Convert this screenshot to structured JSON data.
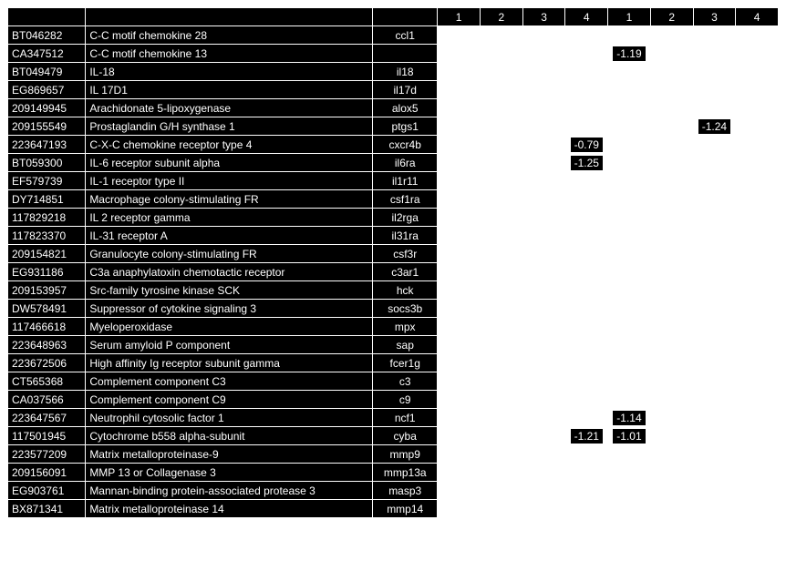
{
  "header": {
    "blank_cols": 3,
    "numbers": [
      "1",
      "2",
      "3",
      "4",
      "1",
      "2",
      "3",
      "4"
    ]
  },
  "rows": [
    {
      "id": "BT046282",
      "name": "C-C motif chemokine 28",
      "gene": "ccl1",
      "vals": [
        "",
        "",
        "",
        "",
        "",
        "",
        "",
        ""
      ]
    },
    {
      "id": "CA347512",
      "name": "C-C motif chemokine 13",
      "gene": "",
      "vals": [
        "",
        "",
        "",
        "",
        "-1.19",
        "",
        "",
        ""
      ]
    },
    {
      "id": "BT049479",
      "name": "IL-18",
      "gene": "il18",
      "vals": [
        "",
        "",
        "",
        "",
        "",
        "",
        "",
        ""
      ]
    },
    {
      "id": "EG869657",
      "name": "IL 17D1",
      "gene": "il17d",
      "vals": [
        "",
        "",
        "",
        "",
        "",
        "",
        "",
        ""
      ]
    },
    {
      "id": "209149945",
      "name": "Arachidonate 5-lipoxygenase",
      "gene": "alox5",
      "vals": [
        "",
        "",
        "",
        "",
        "",
        "",
        "",
        ""
      ]
    },
    {
      "id": "209155549",
      "name": "Prostaglandin G/H synthase 1",
      "gene": "ptgs1",
      "vals": [
        "",
        "",
        "",
        "",
        "",
        "",
        "-1.24",
        ""
      ]
    },
    {
      "id": "223647193",
      "name": "C-X-C chemokine receptor type 4",
      "gene": "cxcr4b",
      "vals": [
        "",
        "",
        "",
        "-0.79",
        "",
        "",
        "",
        ""
      ]
    },
    {
      "id": "BT059300",
      "name": "IL-6 receptor subunit alpha",
      "gene": "il6ra",
      "vals": [
        "",
        "",
        "",
        "-1.25",
        "",
        "",
        "",
        ""
      ]
    },
    {
      "id": "EF579739",
      "name": "IL-1 receptor type II",
      "gene": "il1r11",
      "vals": [
        "",
        "",
        "",
        "",
        "",
        "",
        "",
        ""
      ]
    },
    {
      "id": "DY714851",
      "name": "Macrophage colony-stimulating FR",
      "gene": "csf1ra",
      "vals": [
        "",
        "",
        "",
        "",
        "",
        "",
        "",
        ""
      ]
    },
    {
      "id": "117829218",
      "name": "IL 2 receptor gamma",
      "gene": "il2rga",
      "vals": [
        "",
        "",
        "",
        "",
        "",
        "",
        "",
        ""
      ]
    },
    {
      "id": "117823370",
      "name": "IL-31 receptor A",
      "gene": "il31ra",
      "vals": [
        "",
        "",
        "",
        "",
        "",
        "",
        "",
        ""
      ]
    },
    {
      "id": "209154821",
      "name": "Granulocyte colony-stimulating FR",
      "gene": "csf3r",
      "vals": [
        "",
        "",
        "",
        "",
        "",
        "",
        "",
        ""
      ]
    },
    {
      "id": "EG931186",
      "name": "C3a anaphylatoxin chemotactic receptor",
      "gene": "c3ar1",
      "vals": [
        "",
        "",
        "",
        "",
        "",
        "",
        "",
        ""
      ]
    },
    {
      "id": "209153957",
      "name": "Src-family tyrosine kinase SCK",
      "gene": "hck",
      "vals": [
        "",
        "",
        "",
        "",
        "",
        "",
        "",
        ""
      ]
    },
    {
      "id": "DW578491",
      "name": "Suppressor of cytokine signaling 3",
      "gene": "socs3b",
      "vals": [
        "",
        "",
        "",
        "",
        "",
        "",
        "",
        ""
      ]
    },
    {
      "id": "117466618",
      "name": "Myeloperoxidase",
      "gene": "mpx",
      "vals": [
        "",
        "",
        "",
        "",
        "",
        "",
        "",
        ""
      ]
    },
    {
      "id": "223648963",
      "name": "Serum amyloid P component",
      "gene": "sap",
      "vals": [
        "",
        "",
        "",
        "",
        "",
        "",
        "",
        ""
      ]
    },
    {
      "id": "223672506",
      "name": "High affinity Ig receptor subunit gamma",
      "gene": "fcer1g",
      "vals": [
        "",
        "",
        "",
        "",
        "",
        "",
        "",
        ""
      ]
    },
    {
      "id": "CT565368",
      "name": "Complement component C3",
      "gene": "c3",
      "vals": [
        "",
        "",
        "",
        "",
        "",
        "",
        "",
        ""
      ]
    },
    {
      "id": "CA037566",
      "name": "Complement component C9",
      "gene": "c9",
      "vals": [
        "",
        "",
        "",
        "",
        "",
        "",
        "",
        ""
      ]
    },
    {
      "id": "223647567",
      "name": "Neutrophil cytosolic factor 1",
      "gene": "ncf1",
      "vals": [
        "",
        "",
        "",
        "",
        "-1.14",
        "",
        "",
        ""
      ]
    },
    {
      "id": "117501945",
      "name": "Cytochrome b558 alpha-subunit",
      "gene": "cyba",
      "vals": [
        "",
        "",
        "",
        "-1.21",
        "-1.01",
        "",
        "",
        ""
      ]
    },
    {
      "id": "223577209",
      "name": "Matrix metalloproteinase-9",
      "gene": "mmp9",
      "vals": [
        "",
        "",
        "",
        "",
        "",
        "",
        "",
        ""
      ]
    },
    {
      "id": "209156091",
      "name": "MMP 13 or Collagenase 3",
      "gene": "mmp13a",
      "vals": [
        "",
        "",
        "",
        "",
        "",
        "",
        "",
        ""
      ]
    },
    {
      "id": "EG903761",
      "name": "Mannan-binding protein-associated protease 3",
      "gene": "masp3",
      "vals": [
        "",
        "",
        "",
        "",
        "",
        "",
        "",
        ""
      ]
    },
    {
      "id": "BX871341",
      "name": "Matrix metalloproteinase 14",
      "gene": "mmp14",
      "vals": [
        "",
        "",
        "",
        "",
        "",
        "",
        "",
        ""
      ]
    }
  ]
}
